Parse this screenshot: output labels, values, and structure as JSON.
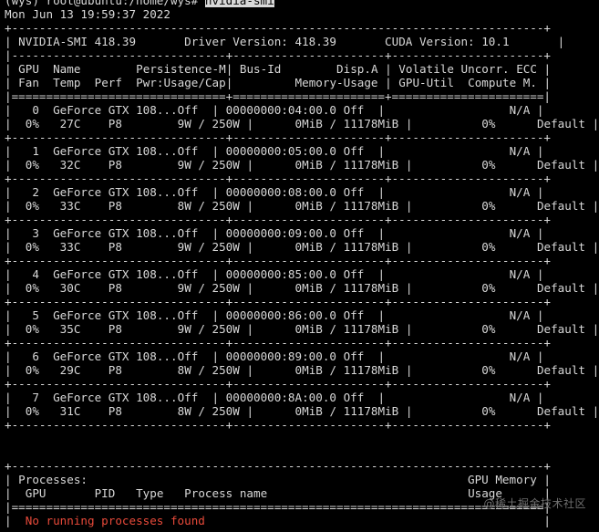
{
  "shell": {
    "prompt": "(wys) root@ubuntu:/home/wys# ",
    "command": "nvidia-smi",
    "timestamp": "Mon Jun 13 19:59:37 2022"
  },
  "header": {
    "smi_version": "NVIDIA-SMI 418.39",
    "driver_version": "Driver Version: 418.39",
    "cuda_version": "CUDA Version: 10.1"
  },
  "columns": {
    "row1": [
      "GPU",
      "Name",
      "Persistence-M",
      "Bus-Id",
      "Disp.A",
      "Volatile",
      "Uncorr. ECC"
    ],
    "row2": [
      "Fan",
      "Temp",
      "Perf",
      "Pwr:Usage/Cap",
      "Memory-Usage",
      "GPU-Util",
      "Compute M."
    ]
  },
  "gpus": [
    {
      "id": "0",
      "name": "GeForce GTX 108...",
      "persistence": "Off",
      "bus": "00000000:04:00.0",
      "disp": "Off",
      "ecc": "N/A",
      "fan": "0%",
      "temp": "27C",
      "perf": "P8",
      "power": "9W / 250W",
      "memory": "0MiB / 11178MiB",
      "util": "0%",
      "compute": "Default"
    },
    {
      "id": "1",
      "name": "GeForce GTX 108...",
      "persistence": "Off",
      "bus": "00000000:05:00.0",
      "disp": "Off",
      "ecc": "N/A",
      "fan": "0%",
      "temp": "32C",
      "perf": "P8",
      "power": "9W / 250W",
      "memory": "0MiB / 11178MiB",
      "util": "0%",
      "compute": "Default"
    },
    {
      "id": "2",
      "name": "GeForce GTX 108...",
      "persistence": "Off",
      "bus": "00000000:08:00.0",
      "disp": "Off",
      "ecc": "N/A",
      "fan": "0%",
      "temp": "33C",
      "perf": "P8",
      "power": "8W / 250W",
      "memory": "0MiB / 11178MiB",
      "util": "0%",
      "compute": "Default"
    },
    {
      "id": "3",
      "name": "GeForce GTX 108...",
      "persistence": "Off",
      "bus": "00000000:09:00.0",
      "disp": "Off",
      "ecc": "N/A",
      "fan": "0%",
      "temp": "33C",
      "perf": "P8",
      "power": "9W / 250W",
      "memory": "0MiB / 11178MiB",
      "util": "0%",
      "compute": "Default"
    },
    {
      "id": "4",
      "name": "GeForce GTX 108...",
      "persistence": "Off",
      "bus": "00000000:85:00.0",
      "disp": "Off",
      "ecc": "N/A",
      "fan": "0%",
      "temp": "30C",
      "perf": "P8",
      "power": "9W / 250W",
      "memory": "0MiB / 11178MiB",
      "util": "0%",
      "compute": "Default"
    },
    {
      "id": "5",
      "name": "GeForce GTX 108...",
      "persistence": "Off",
      "bus": "00000000:86:00.0",
      "disp": "Off",
      "ecc": "N/A",
      "fan": "0%",
      "temp": "35C",
      "perf": "P8",
      "power": "9W / 250W",
      "memory": "0MiB / 11178MiB",
      "util": "0%",
      "compute": "Default"
    },
    {
      "id": "6",
      "name": "GeForce GTX 108...",
      "persistence": "Off",
      "bus": "00000000:89:00.0",
      "disp": "Off",
      "ecc": "N/A",
      "fan": "0%",
      "temp": "29C",
      "perf": "P8",
      "power": "8W / 250W",
      "memory": "0MiB / 11178MiB",
      "util": "0%",
      "compute": "Default"
    },
    {
      "id": "7",
      "name": "GeForce GTX 108...",
      "persistence": "Off",
      "bus": "00000000:8A:00.0",
      "disp": "Off",
      "ecc": "N/A",
      "fan": "0%",
      "temp": "31C",
      "perf": "P8",
      "power": "8W / 250W",
      "memory": "0MiB / 11178MiB",
      "util": "0%",
      "compute": "Default"
    }
  ],
  "processes": {
    "title": "Processes:",
    "memory_header": "GPU Memory",
    "columns": [
      "GPU",
      "PID",
      "Type",
      "Process name",
      "Usage"
    ],
    "empty_message": "No running processes found"
  },
  "watermark": "@稀土掘金技术社区",
  "colors": {
    "background": "#000000",
    "text": "#d8d8d8",
    "error": "#e84a3a"
  }
}
